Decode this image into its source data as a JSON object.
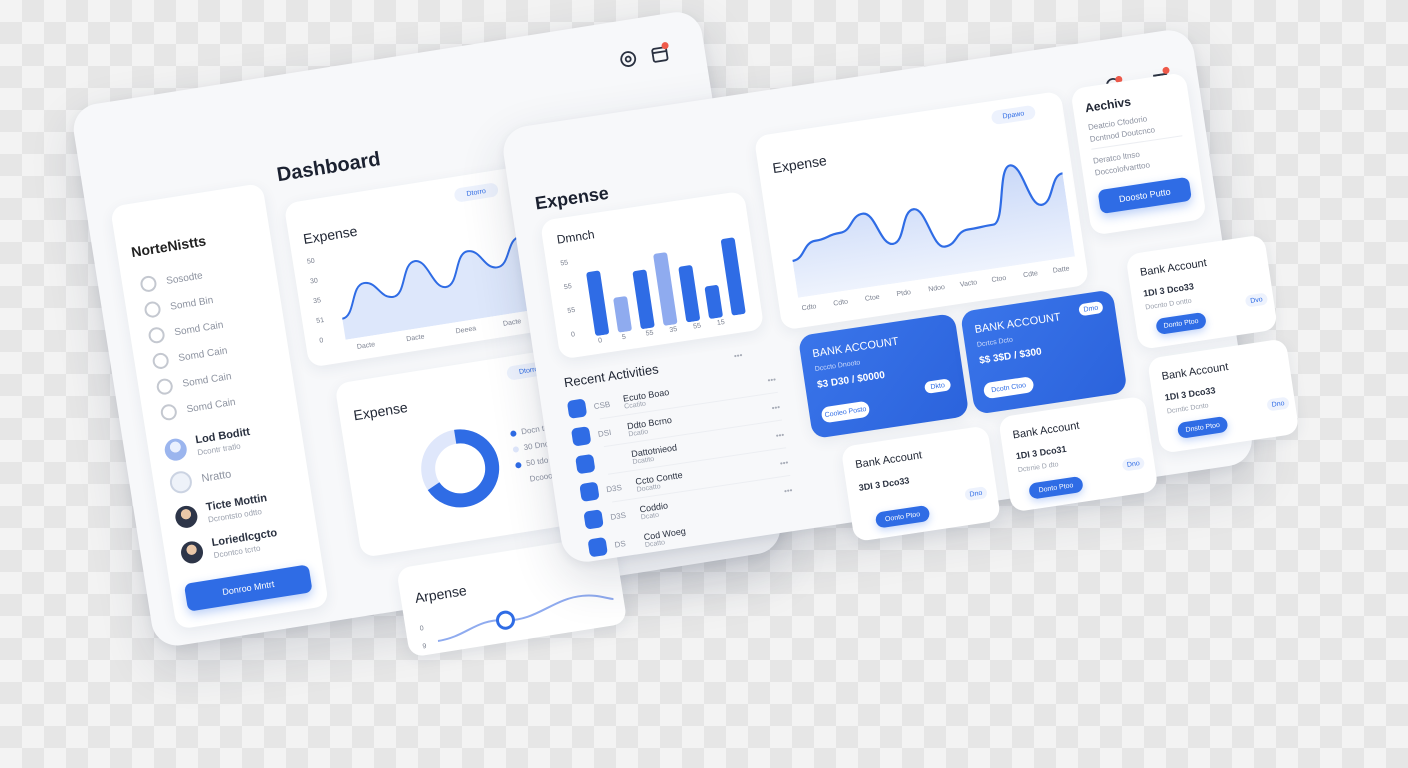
{
  "colors": {
    "accent": "#2f6ce5",
    "accent_light": "#8fabef",
    "area_fill": "#d9e4fb",
    "donut_track": "#dfe7fb",
    "badge": "#ef5a4a"
  },
  "left_panel": {
    "title": "Dashboard",
    "header_icons": [
      "settings-icon",
      "calendar-icon"
    ],
    "sidebar": {
      "title": "NorteNistts",
      "items": [
        {
          "label": "Sosodte",
          "icon": "circle-icon"
        },
        {
          "label": "Somd Bin",
          "icon": "gear-icon"
        },
        {
          "label": "Somd Cain",
          "icon": "gear-icon"
        },
        {
          "label": "Somd Cain",
          "icon": "gear-icon"
        },
        {
          "label": "Somd Cain",
          "icon": "settings-icon"
        },
        {
          "label": "Somd Cain",
          "icon": "circle-icon"
        }
      ],
      "people": [
        {
          "name": "Lod Boditt",
          "sub": "Dcontr tratlo"
        },
        {
          "name": "Nratto",
          "sub": ""
        },
        {
          "name": "Ticte Mottin",
          "sub": "Dcrontsto odtto"
        },
        {
          "name": "Loriedlcgcto",
          "sub": "Dcontco tcrto"
        }
      ],
      "button": "Donroo Mntrt"
    },
    "expense_card": {
      "title": "Expense",
      "pill": "Dtorro",
      "yticks": [
        "50",
        "30",
        "35",
        "51",
        "0"
      ],
      "xticks": [
        "Dacte",
        "Dacte",
        "Deeea",
        "Dacte"
      ]
    },
    "donut_card": {
      "title": "Expense",
      "pill": "Dtorro",
      "legend": [
        {
          "label": "Docn trstae"
        },
        {
          "label": "30  Dno"
        },
        {
          "label": "50  tdo"
        },
        {
          "label": "Dcooo"
        }
      ]
    },
    "bottom_card": {
      "title": "Arpense",
      "yticks": [
        "0",
        "9"
      ]
    }
  },
  "right_panel": {
    "header_icons": [
      "headset-icon",
      "menu-icon"
    ],
    "expense_bar_card": {
      "title": "Expense",
      "subtitle": "Dmnch",
      "yticks": [
        "55",
        "55",
        "55",
        "0"
      ],
      "xticks": [
        "0",
        "5",
        "55",
        "35",
        "55",
        "15"
      ]
    },
    "expense_area_card": {
      "title": "Expense",
      "pill": "Dpawo",
      "xticks": [
        "Cdto",
        "Cdto",
        "Ctoe",
        "Ptdo",
        "Ndoo",
        "Vacto",
        "Ctoo",
        "Cdte",
        "Datte"
      ]
    },
    "actions_card": {
      "title": "Aechivs",
      "lines": [
        "Deatcio Cfodorio",
        "Dcntnod Doutcnco",
        "Deratco ltnso",
        "Doccolofvarttoo"
      ],
      "button": "Doosto Putto"
    },
    "recent": {
      "title": "Recent Activities",
      "more": "•••",
      "items": [
        {
          "code": "CSB",
          "name": "Ecuto Boao",
          "sub": "Ccatito"
        },
        {
          "code": "DSI",
          "name": "Ddto Bcrno",
          "sub": "Dcatio"
        },
        {
          "code": "",
          "name": "Dattotnieod",
          "sub": "Dcatito"
        },
        {
          "code": "D3S",
          "name": "Ccto Contte",
          "sub": "Docatto"
        },
        {
          "code": "D3S",
          "name": "Coddio",
          "sub": "Dcato"
        },
        {
          "code": "DS",
          "name": "Cod Woeg",
          "sub": "Dcatto"
        }
      ]
    },
    "bank_cards": [
      {
        "title": "BANK ACCOUNT",
        "sub": "Dcccto Dnooto",
        "number": "$3 D30 / $0000",
        "button": "Cooleo Posto",
        "tag": "Dkto"
      },
      {
        "title": "BANK ACCOUNT",
        "sub": "Dcrtcs Dcto",
        "number": "$$ 3$D / $300",
        "button": "Dcotn Ctoo",
        "tag": "Dmo"
      },
      {
        "title": "Bank Account",
        "number": "3DI 3 Dco33",
        "button": "Oonto Ptoo",
        "tag": "Dno"
      },
      {
        "title": "Bank Account",
        "number": "1DI 3 Dco31",
        "sub": "Dctrnie D dto",
        "button": "Donto Ptoo",
        "tag": "Dno"
      },
      {
        "title": "Bank Account",
        "number": "1DI 3 Dco33",
        "sub": "Docnto D ontto",
        "button": "Donto Ptoo",
        "tag": "Dvo"
      },
      {
        "title": "Bank Account",
        "number": "1DI 3 Dco33",
        "sub": "Dcrntic Dcnto",
        "button": "Dnsto Ptoo",
        "tag": "Dno"
      }
    ]
  },
  "left_chart": {
    "chart_data": {
      "type": "area",
      "title": "Expense",
      "x": [
        "Dacte",
        "Dacte",
        "Deeea",
        "Dacte"
      ],
      "y_relative": [
        0.2,
        0.62,
        0.38,
        0.8,
        0.4,
        0.82,
        0.55,
        0.9
      ]
    }
  },
  "bar_chart": {
    "chart_data": {
      "type": "bar",
      "title": "Dmnch",
      "values": [
        55,
        30,
        50,
        62,
        48,
        28,
        66
      ],
      "highlight": [
        true,
        false,
        true,
        false,
        true,
        true,
        true
      ]
    }
  },
  "area_chart": {
    "chart_data": {
      "type": "area",
      "title": "Expense",
      "values": [
        30,
        46,
        50,
        65,
        32,
        62,
        22,
        35,
        36,
        90,
        48,
        75
      ]
    }
  },
  "donut_chart": {
    "chart_data": {
      "type": "pie",
      "title": "Expense",
      "slices": [
        {
          "value": 68,
          "color": "#2f6ce5"
        },
        {
          "value": 32,
          "color": "#dfe7fb"
        }
      ]
    }
  }
}
